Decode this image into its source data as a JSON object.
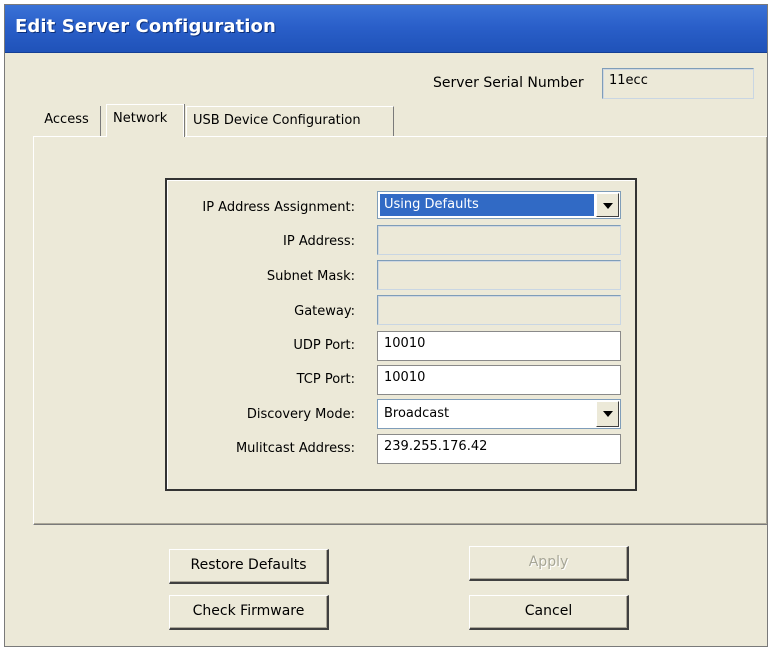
{
  "window": {
    "title": "Edit Server Configuration"
  },
  "serial": {
    "label": "Server Serial Number",
    "value": "11ecc"
  },
  "tabs": [
    {
      "label": "Access"
    },
    {
      "label": "Network"
    },
    {
      "label": "USB Device Configuration"
    }
  ],
  "network": {
    "ip_assignment": {
      "label": "IP Address Assignment:",
      "value": "Using Defaults"
    },
    "ip_address": {
      "label": "IP Address:",
      "value": ""
    },
    "subnet_mask": {
      "label": "Subnet Mask:",
      "value": ""
    },
    "gateway": {
      "label": "Gateway:",
      "value": ""
    },
    "udp_port": {
      "label": "UDP Port:",
      "value": "10010"
    },
    "tcp_port": {
      "label": "TCP Port:",
      "value": "10010"
    },
    "discovery_mode": {
      "label": "Discovery Mode:",
      "value": "Broadcast"
    },
    "multicast_address": {
      "label": "Mulitcast Address:",
      "value": "239.255.176.42"
    }
  },
  "buttons": {
    "restore_defaults": "Restore Defaults",
    "apply": "Apply",
    "check_firmware": "Check Firmware",
    "cancel": "Cancel"
  }
}
